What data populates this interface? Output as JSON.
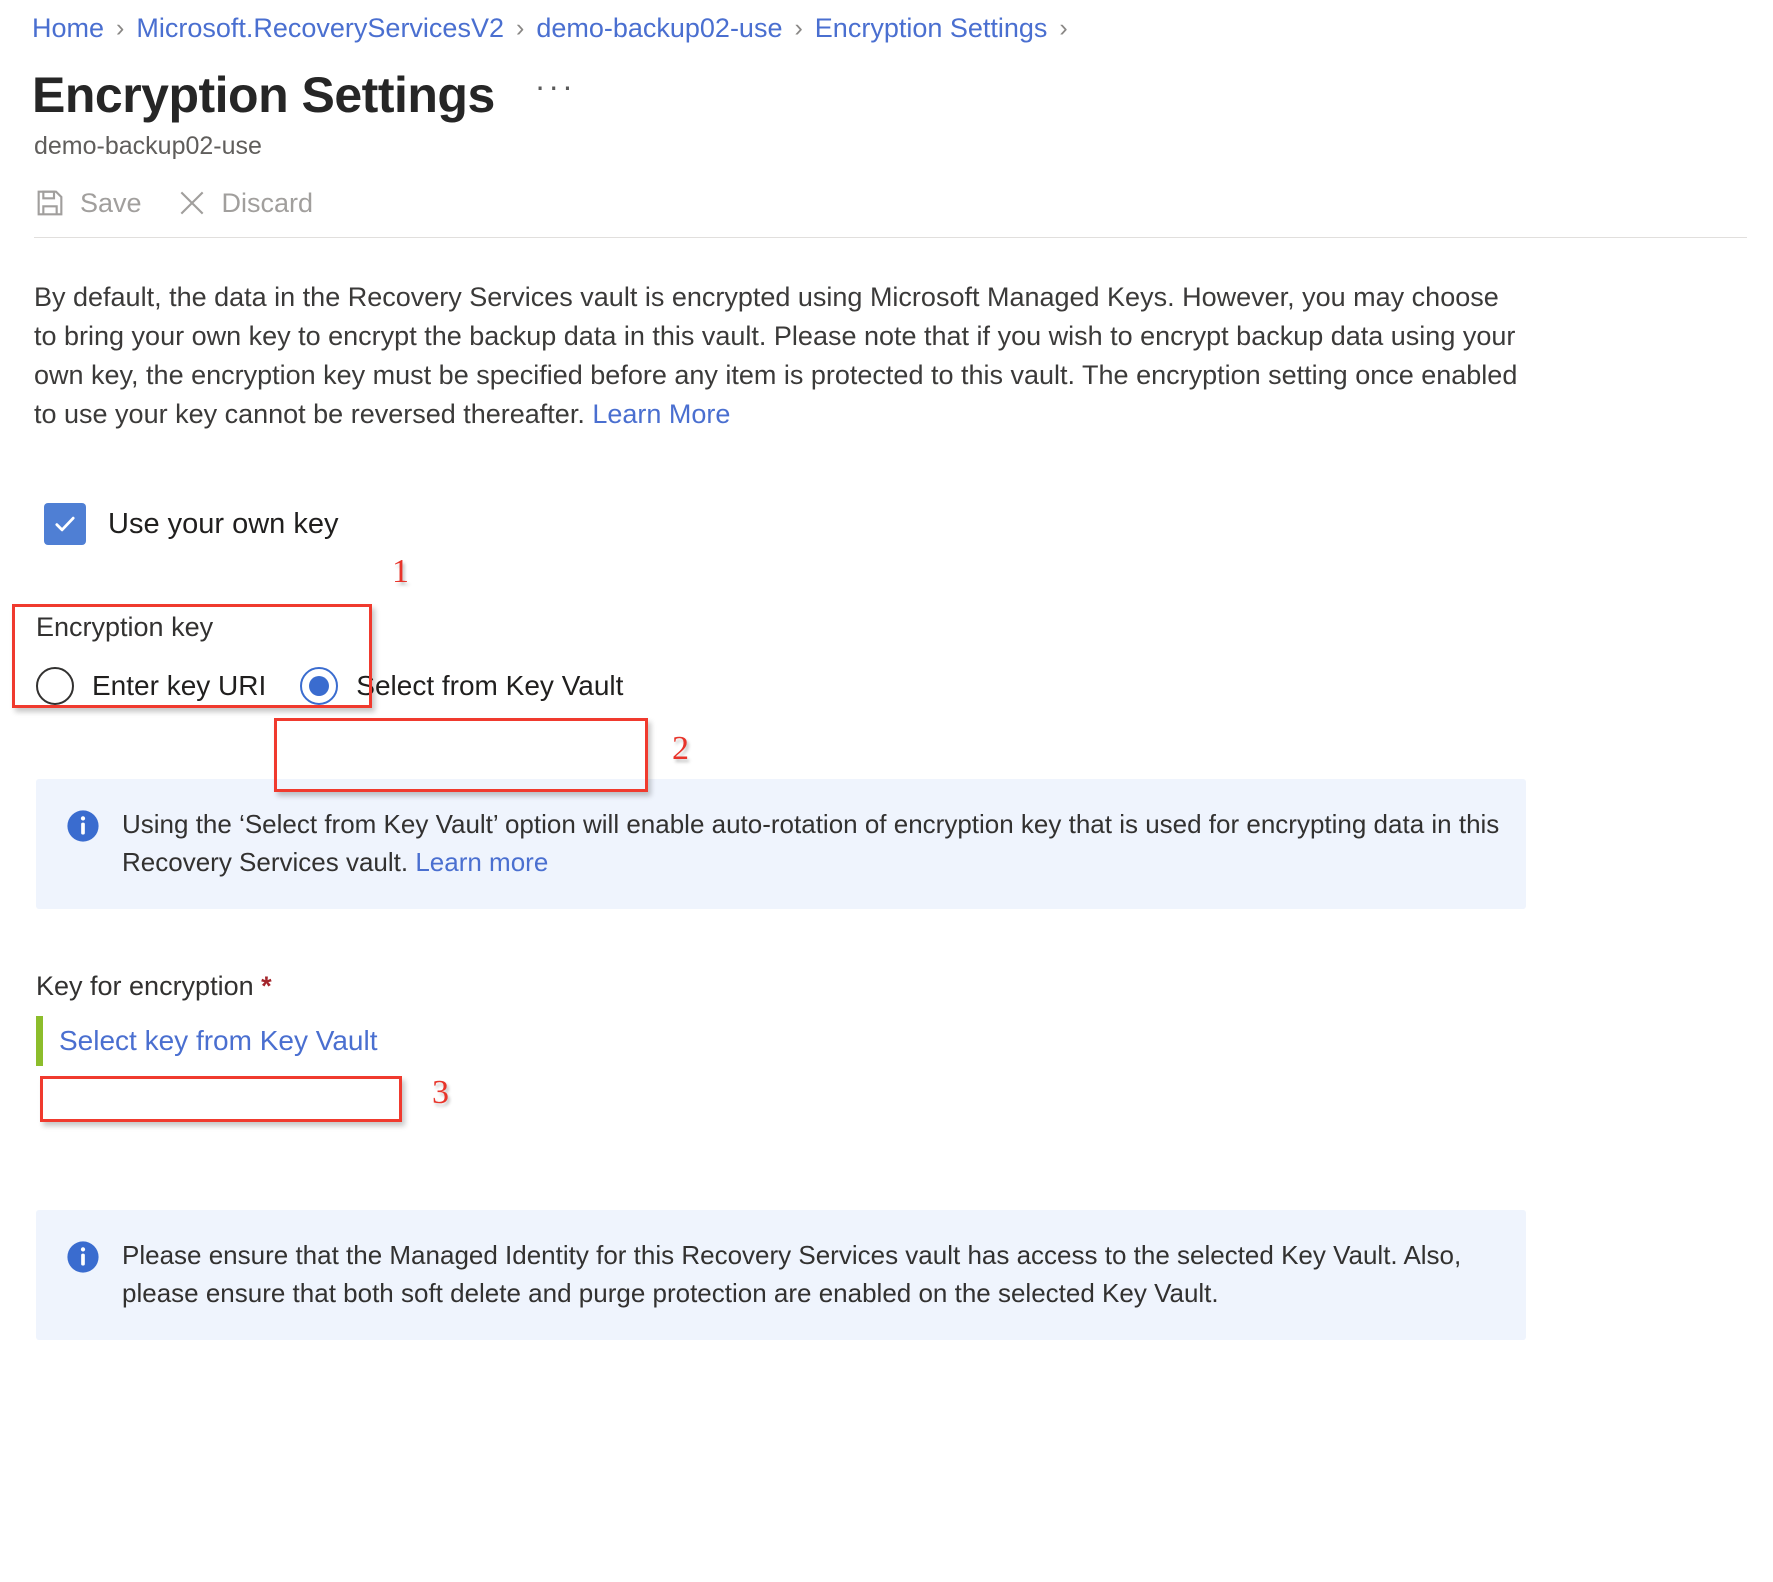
{
  "breadcrumb": {
    "items": [
      {
        "label": "Home"
      },
      {
        "label": "Microsoft.RecoveryServicesV2"
      },
      {
        "label": "demo-backup02-use"
      },
      {
        "label": "Encryption Settings"
      }
    ],
    "separator": "›"
  },
  "header": {
    "title": "Encryption Settings",
    "more_label": "···",
    "subtitle": "demo-backup02-use"
  },
  "commandbar": {
    "save_label": "Save",
    "discard_label": "Discard"
  },
  "description": {
    "text": "By default, the data in the Recovery Services vault is encrypted using Microsoft Managed Keys. However, you may choose to bring your own key to encrypt the backup data in this vault. Please note that if you wish to encrypt backup data using your own key, the encryption key must be specified before any item is protected to this vault. The encryption setting once enabled to use your key cannot be reversed thereafter. ",
    "link_label": "Learn More"
  },
  "use_own_key": {
    "label": "Use your own key",
    "checked": true,
    "check_glyph": "✓"
  },
  "encryption_key": {
    "label": "Encryption key",
    "options": [
      {
        "label": "Enter key URI",
        "selected": false
      },
      {
        "label": "Select from Key Vault",
        "selected": true
      }
    ]
  },
  "info_banner_top": {
    "text": "Using the ‘Select from Key Vault’ option will enable auto-rotation of encryption key that is used for encrypting data in this Recovery Services vault. ",
    "link_label": "Learn more"
  },
  "key_for_encryption": {
    "label": "Key for encryption ",
    "required_marker": "*",
    "link_label": "Select key from Key Vault"
  },
  "info_banner_bottom": {
    "text": "Please ensure that the Managed Identity for this Recovery Services vault has access to the selected Key Vault. Also, please ensure that both soft delete and purge protection are enabled on the selected Key Vault."
  },
  "annotations": [
    {
      "number": "1"
    },
    {
      "number": "2"
    },
    {
      "number": "3"
    }
  ],
  "colors": {
    "link": "#4a6fd0",
    "accent_checkbox": "#4f7fd4",
    "accent_radio": "#3a6ccf",
    "banner_bg": "#eff4fd",
    "annotation_red": "#e8342a",
    "required_star": "#a4262c",
    "validation_green": "#8cbd2b"
  }
}
